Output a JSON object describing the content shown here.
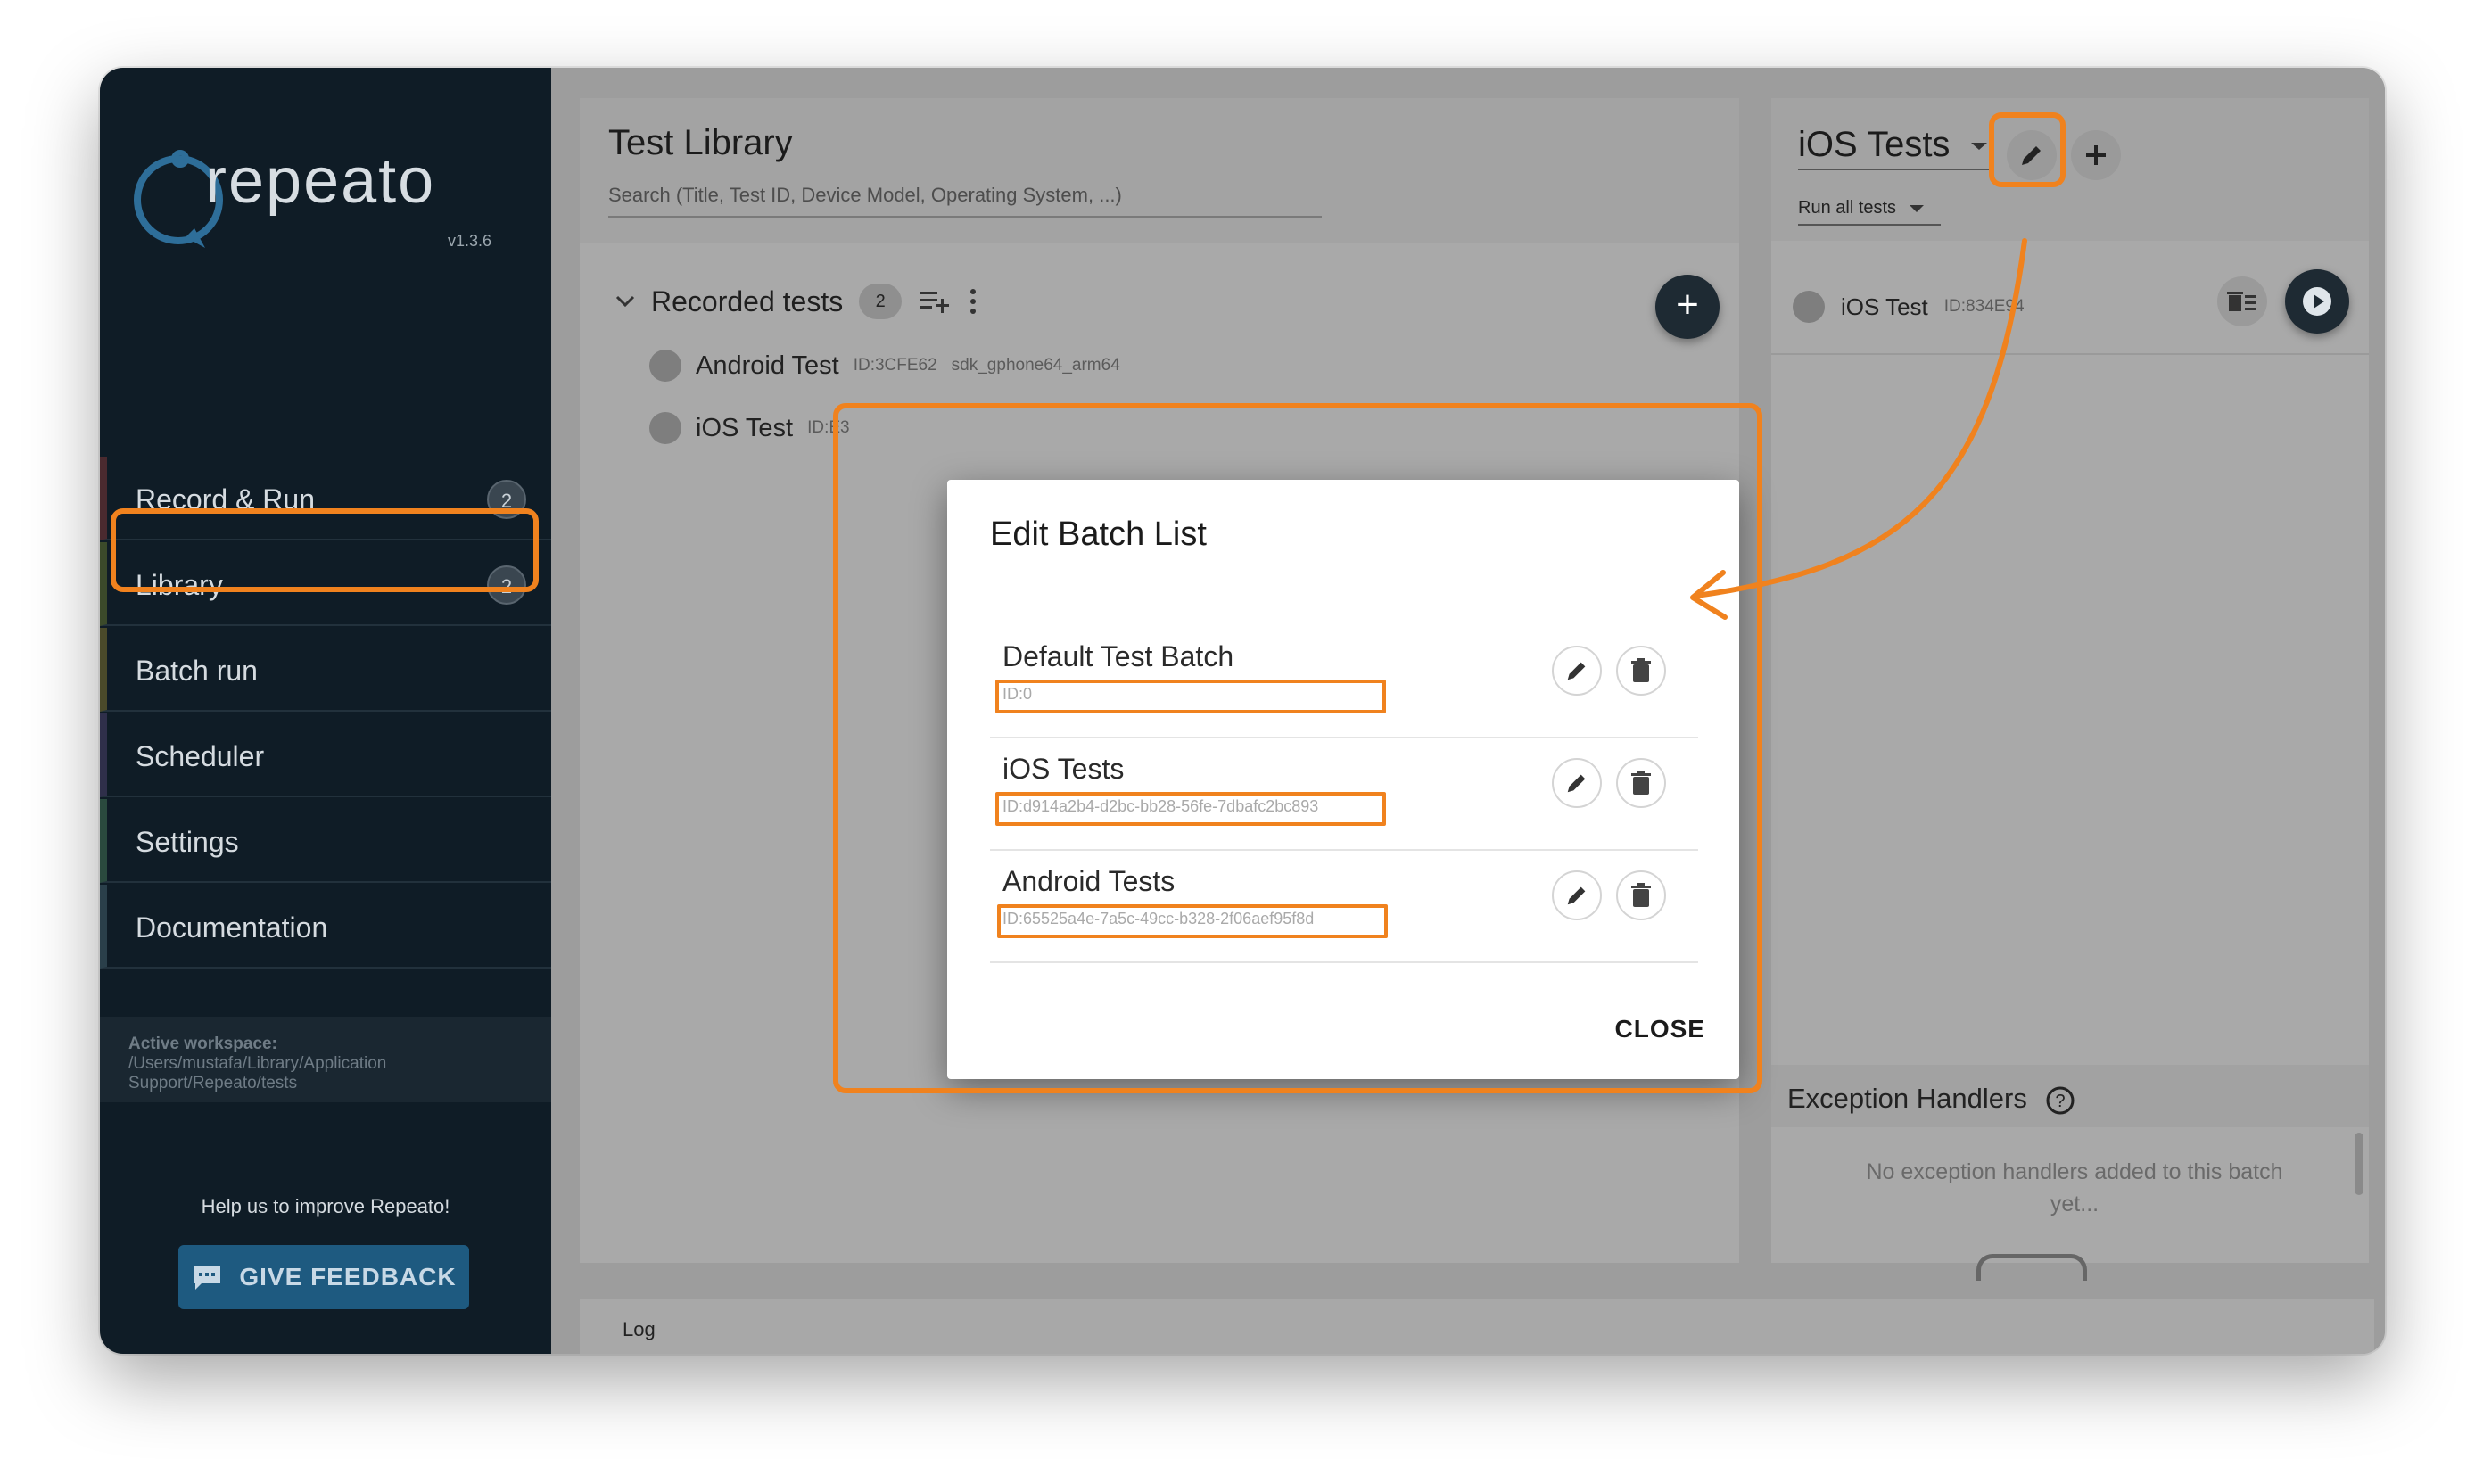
{
  "app": {
    "logo_text": "repeato",
    "version": "v1.3.6"
  },
  "sidebar": {
    "items": [
      {
        "label": "Record & Run",
        "badge": "2"
      },
      {
        "label": "Library",
        "badge": "2"
      },
      {
        "label": "Batch run"
      },
      {
        "label": "Scheduler"
      },
      {
        "label": "Settings"
      },
      {
        "label": "Documentation"
      }
    ],
    "workspace_label": "Active workspace:",
    "workspace_path_1": "/Users/mustafa/Library/Application",
    "workspace_path_2": "Support/Repeato/tests",
    "help_text": "Help us to improve Repeato!",
    "feedback_label": "GIVE FEEDBACK"
  },
  "library": {
    "title": "Test Library",
    "search_placeholder": "Search (Title, Test ID, Device Model, Operating System, ...)",
    "group_title": "Recorded tests",
    "group_count": "2",
    "tests": [
      {
        "name": "Android Test",
        "id": "ID:3CFE62",
        "device": "sdk_gphone64_arm64"
      },
      {
        "name": "iOS Test",
        "id": "ID:E3"
      }
    ]
  },
  "batch": {
    "title": "iOS Tests",
    "run_all": "Run all tests",
    "test_name": "iOS Test",
    "test_id": "ID:834E94",
    "exception_title": "Exception Handlers",
    "exception_empty_1": "No exception handlers added to this batch",
    "exception_empty_2": "yet..."
  },
  "log": {
    "label": "Log"
  },
  "dialog": {
    "title": "Edit Batch List",
    "rows": [
      {
        "name": "Default Test Batch",
        "id": "ID:0"
      },
      {
        "name": "iOS Tests",
        "id": "ID:d914a2b4-d2bc-bb28-56fe-7dbafc2bc893"
      },
      {
        "name": "Android Tests",
        "id": "ID:65525a4e-7a5c-49cc-b328-2f06aef95f8d"
      }
    ],
    "close_label": "CLOSE"
  },
  "colors": {
    "annotation": "#f0821e",
    "sidebar_bg": "#0f1c26",
    "feedback_btn": "#1e5a80"
  }
}
